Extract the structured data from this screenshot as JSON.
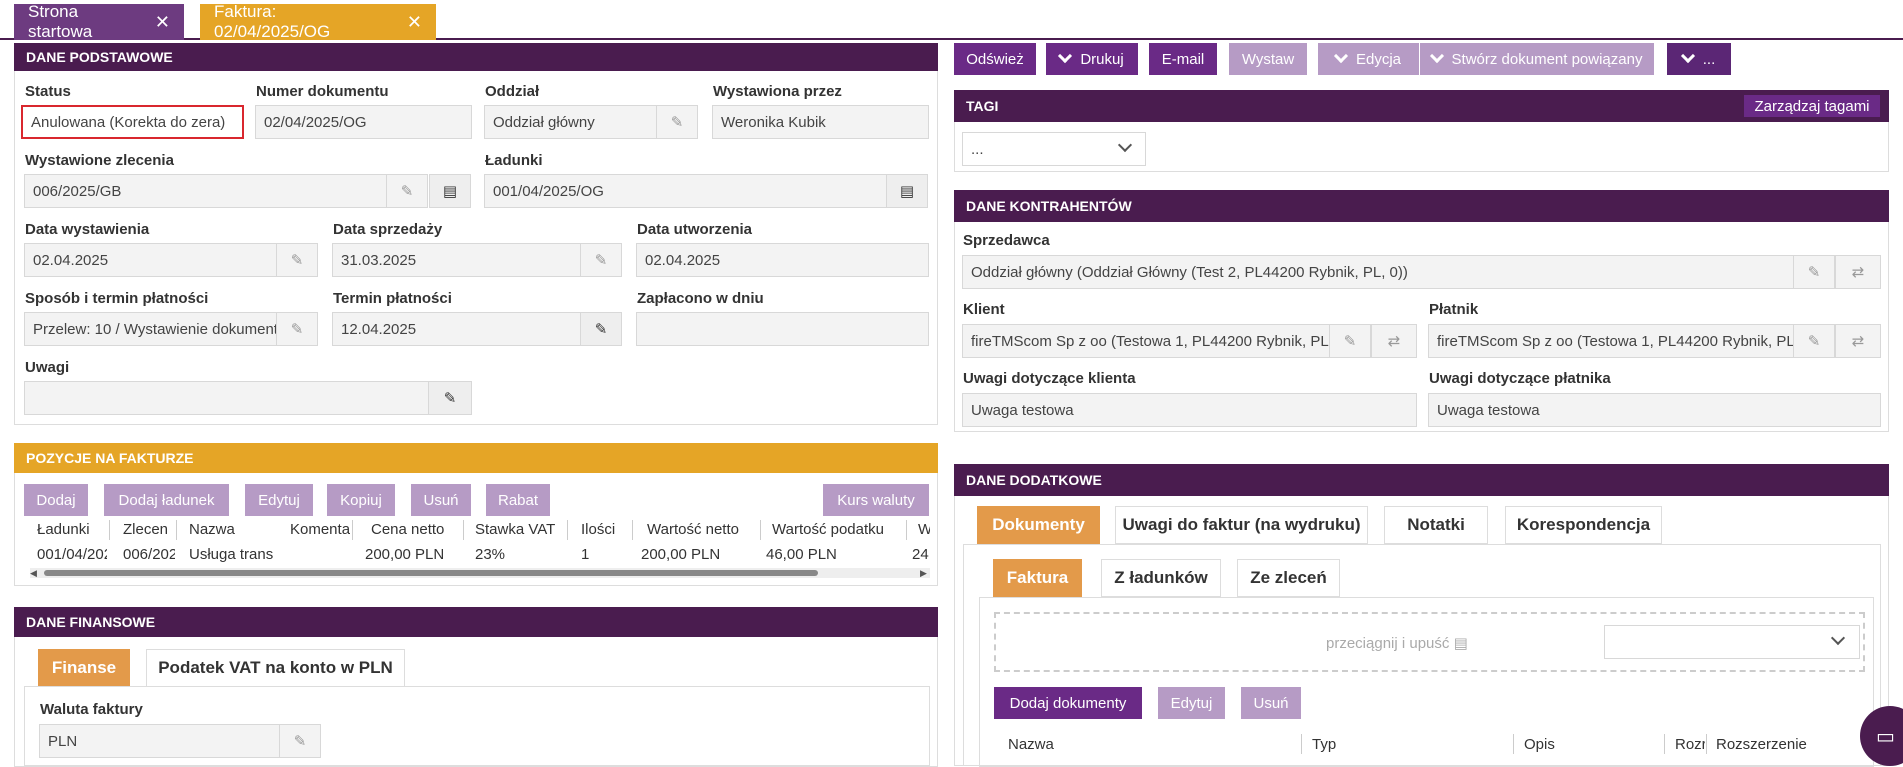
{
  "tabs": [
    {
      "label": "Strona startowa"
    },
    {
      "label": "Faktura: 02/04/2025/OG"
    }
  ],
  "toolbar": {
    "refresh": "Odśwież",
    "print": "Drukuj",
    "email": "E-mail",
    "issue": "Wystaw",
    "edit": "Edycja",
    "create_related": "Stwórz dokument powiązany",
    "more": "..."
  },
  "basic": {
    "title": "DANE PODSTAWOWE",
    "status_label": "Status",
    "status_value": "Anulowana (Korekta do zera)",
    "docnum_label": "Numer dokumentu",
    "docnum_value": "02/04/2025/OG",
    "branch_label": "Oddział",
    "branch_value": "Oddział główny",
    "issued_by_label": "Wystawiona przez",
    "issued_by_value": "Weronika Kubik",
    "orders_label": "Wystawione zlecenia",
    "orders_value": "006/2025/GB",
    "loads_label": "Ładunki",
    "loads_value": "001/04/2025/OG",
    "issue_date_label": "Data wystawienia",
    "issue_date_value": "02.04.2025",
    "sale_date_label": "Data sprzedaży",
    "sale_date_value": "31.03.2025",
    "created_label": "Data utworzenia",
    "created_value": "02.04.2025",
    "payment_method_label": "Sposób i termin płatności",
    "payment_method_value": "Przelew: 10 / Wystawienie dokumentu",
    "payment_due_label": "Termin płatności",
    "payment_due_value": "12.04.2025",
    "paid_label": "Zapłacono w dniu",
    "paid_value": "",
    "notes_label": "Uwagi",
    "notes_value": ""
  },
  "positions": {
    "title": "POZYCJE NA FAKTURZE",
    "buttons": {
      "add": "Dodaj",
      "add_load": "Dodaj ładunek",
      "edit": "Edytuj",
      "copy": "Kopiuj",
      "delete": "Usuń",
      "discount": "Rabat",
      "currency": "Kurs waluty"
    },
    "columns": [
      "Ładunki",
      "Zlecen",
      "Nazwa",
      "Komenta",
      "Cena netto",
      "Stawka VAT",
      "Ilości",
      "Wartość netto",
      "Wartość podatku",
      "W"
    ],
    "rows": [
      [
        "001/04/202",
        "006/202",
        "Usługa trans",
        "",
        "200,00 PLN",
        "23%",
        "1",
        "200,00 PLN",
        "46,00 PLN",
        "24"
      ]
    ]
  },
  "finance": {
    "title": "DANE FINANSOWE",
    "tab_finance": "Finanse",
    "tab_vat": "Podatek VAT na konto w PLN",
    "currency_label": "Waluta faktury",
    "currency_value": "PLN"
  },
  "tags": {
    "title": "TAGI",
    "manage": "Zarządzaj tagami",
    "select_value": "..."
  },
  "contractors": {
    "title": "DANE KONTRAHENTÓW",
    "seller_label": "Sprzedawca",
    "seller_value": "Oddział główny  (Oddział Główny  (Test 2, PL44200 Rybnik, PL, 0))",
    "client_label": "Klient",
    "client_value": "fireTMScom Sp z oo (Testowa 1, PL44200 Rybnik, PL",
    "payer_label": "Płatnik",
    "payer_value": "fireTMScom Sp z oo (Testowa 1, PL44200 Rybnik, PL",
    "client_notes_label": "Uwagi dotyczące klienta",
    "client_notes_value": "Uwaga testowa",
    "payer_notes_label": "Uwagi dotyczące płatnika",
    "payer_notes_value": "Uwaga testowa"
  },
  "extra": {
    "title": "DANE DODATKOWE",
    "tabs": [
      "Dokumenty",
      "Uwagi do faktur (na wydruku)",
      "Notatki",
      "Korespondencja"
    ],
    "subtabs": [
      "Faktura",
      "Z ładunków",
      "Ze zleceń"
    ],
    "dropzone": "przeciągnij i upuść",
    "add_docs": "Dodaj dokumenty",
    "edit": "Edytuj",
    "delete": "Usuń",
    "columns": [
      "Nazwa",
      "Typ",
      "Opis",
      "Rozr",
      "Rozszerzenie"
    ]
  },
  "colors": {
    "purple": "#4a1c4f",
    "gold": "#e5a526",
    "light_purple": "#b69bc5",
    "dark_purple": "#6a2a86"
  }
}
